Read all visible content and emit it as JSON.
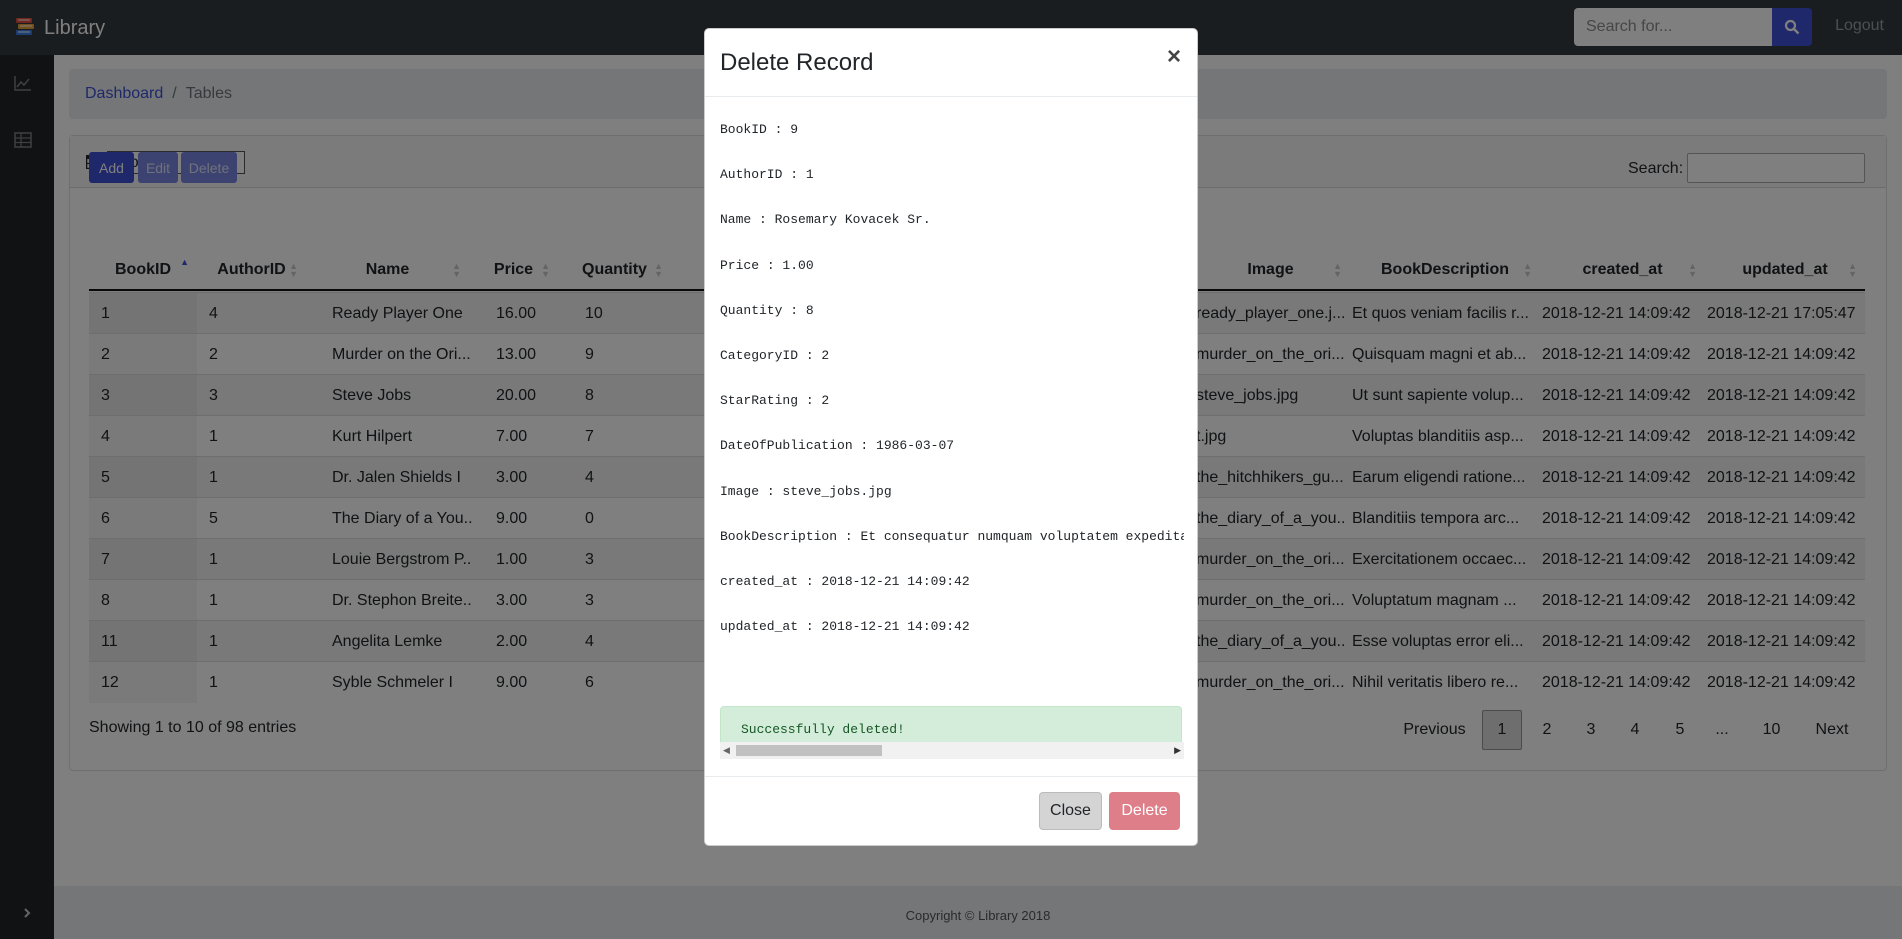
{
  "navbar": {
    "brand": "Library",
    "search_placeholder": "Search for...",
    "logout_label": "Logout"
  },
  "sidebar": {
    "items": [
      {
        "icon": "area-chart-icon"
      },
      {
        "icon": "table-icon"
      }
    ]
  },
  "breadcrumb": {
    "link": "Dashboard",
    "separator": "/",
    "current": "Tables"
  },
  "table_selector": {
    "value": "books"
  },
  "toolbar": {
    "add_label": "Add",
    "edit_label": "Edit",
    "delete_label": "Delete",
    "search_label": "Search:"
  },
  "table": {
    "columns": [
      "BookID",
      "AuthorID",
      "Name",
      "Price",
      "Quantity",
      "Image",
      "BookDescription",
      "created_at",
      "updated_at"
    ],
    "rows": [
      [
        "1",
        "4",
        "Ready Player One",
        "16.00",
        "10",
        "ready_player_one.j...",
        "Et quos veniam facilis r...",
        "2018-12-21 14:09:42",
        "2018-12-21 17:05:47"
      ],
      [
        "2",
        "2",
        "Murder on the Ori...",
        "13.00",
        "9",
        "murder_on_the_ori...",
        "Quisquam magni et ab...",
        "2018-12-21 14:09:42",
        "2018-12-21 14:09:42"
      ],
      [
        "3",
        "3",
        "Steve Jobs",
        "20.00",
        "8",
        "steve_jobs.jpg",
        "Ut sunt sapiente volup...",
        "2018-12-21 14:09:42",
        "2018-12-21 14:09:42"
      ],
      [
        "4",
        "1",
        "Kurt Hilpert",
        "7.00",
        "7",
        "t.jpg",
        "Voluptas blanditiis asp...",
        "2018-12-21 14:09:42",
        "2018-12-21 14:09:42"
      ],
      [
        "5",
        "1",
        "Dr. Jalen Shields I",
        "3.00",
        "4",
        "the_hitchhikers_gu...",
        "Earum eligendi ratione...",
        "2018-12-21 14:09:42",
        "2018-12-21 14:09:42"
      ],
      [
        "6",
        "5",
        "The Diary of a You...",
        "9.00",
        "0",
        "the_diary_of_a_you...",
        "Blanditiis tempora arc...",
        "2018-12-21 14:09:42",
        "2018-12-21 14:09:42"
      ],
      [
        "7",
        "1",
        "Louie Bergstrom P...",
        "1.00",
        "3",
        "murder_on_the_ori...",
        "Exercitationem occaec...",
        "2018-12-21 14:09:42",
        "2018-12-21 14:09:42"
      ],
      [
        "8",
        "1",
        "Dr. Stephon Breite...",
        "3.00",
        "3",
        "murder_on_the_ori...",
        "Voluptatum magnam ...",
        "2018-12-21 14:09:42",
        "2018-12-21 14:09:42"
      ],
      [
        "11",
        "1",
        "Angelita Lemke",
        "2.00",
        "4",
        "the_diary_of_a_you...",
        "Esse voluptas error eli...",
        "2018-12-21 14:09:42",
        "2018-12-21 14:09:42"
      ],
      [
        "12",
        "1",
        "Syble Schmeler I",
        "9.00",
        "6",
        "murder_on_the_ori...",
        "Nihil veritatis libero re...",
        "2018-12-21 14:09:42",
        "2018-12-21 14:09:42"
      ]
    ]
  },
  "table_info": "Showing 1 to 10 of 98 entries",
  "pagination": {
    "previous": "Previous",
    "pages": [
      "1",
      "2",
      "3",
      "4",
      "5",
      "...",
      "10"
    ],
    "current": "1",
    "next": "Next"
  },
  "footer": "Copyright © Library 2018",
  "modal": {
    "title": "Delete Record",
    "close_glyph": "×",
    "fields": [
      {
        "label": "BookID",
        "value": "9"
      },
      {
        "label": "AuthorID",
        "value": "1"
      },
      {
        "label": "Name",
        "value": "Rosemary Kovacek Sr."
      },
      {
        "label": "Price",
        "value": "1.00"
      },
      {
        "label": "Quantity",
        "value": "8"
      },
      {
        "label": "CategoryID",
        "value": "2"
      },
      {
        "label": "StarRating",
        "value": "2"
      },
      {
        "label": "DateOfPublication",
        "value": "1986-03-07"
      },
      {
        "label": "Image",
        "value": "steve_jobs.jpg"
      },
      {
        "label": "BookDescription",
        "value": "Et consequatur numquam voluptatem expedita"
      },
      {
        "label": "created_at",
        "value": "2018-12-21 14:09:42"
      },
      {
        "label": "updated_at",
        "value": "2018-12-21 14:09:42"
      }
    ],
    "alert": "Successfully deleted!",
    "close_label": "Close",
    "delete_label": "Delete"
  },
  "colors": {
    "primary": "#3f51d6",
    "navbar": "#343a40",
    "sidebar": "#212529",
    "success_bg": "#d4edda",
    "danger_disabled": "#dd7e89"
  }
}
